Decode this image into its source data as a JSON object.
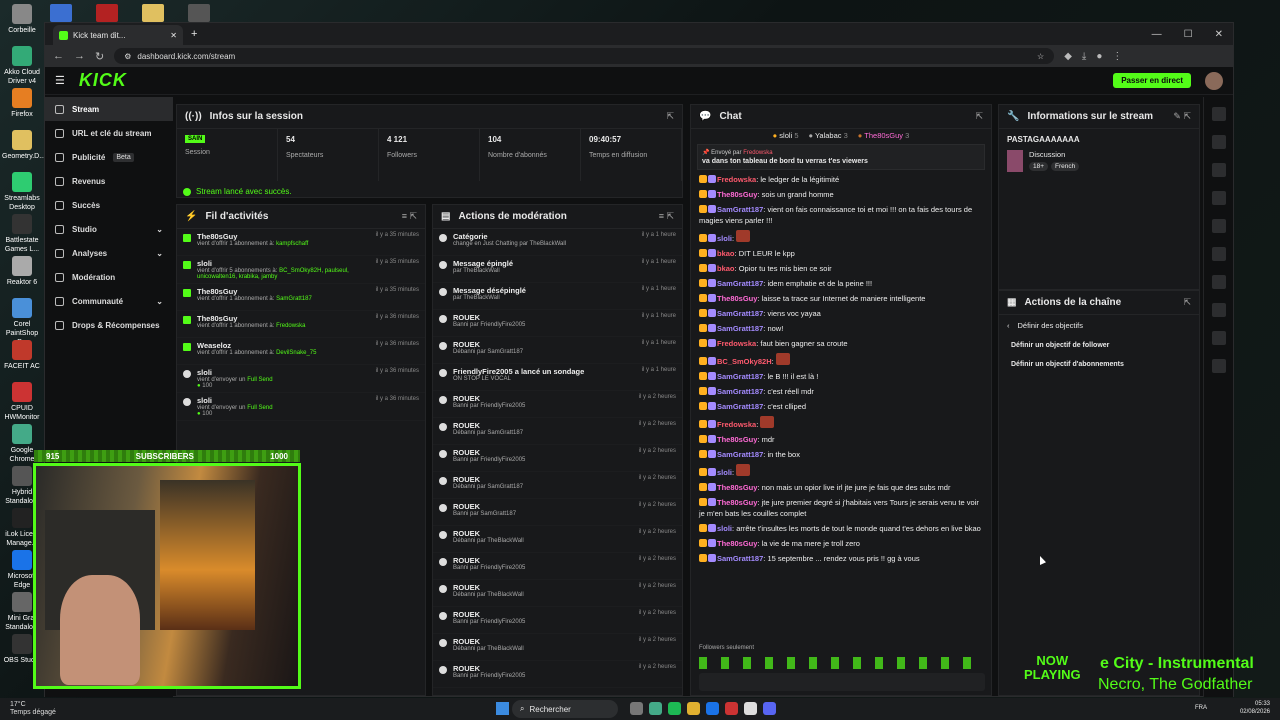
{
  "desktop": {
    "icons": [
      "Corbeille",
      "Akko Cloud Driver v4",
      "Firefox",
      "Geometry.D...",
      "Streamlabs Desktop",
      "Battlestate Games L...",
      "Reaktor 6",
      "Corel PaintShop P...",
      "FACEIT AC",
      "CPUID HWMonitor",
      "Google Chrome",
      "Hybrid Standalo...",
      "iLok Licen. Manage...",
      "Microsoft Edge",
      "Mini Gra. Standalo...",
      "OBS Studio"
    ]
  },
  "browser": {
    "tab_title": "Kick team dit...",
    "url": "dashboard.kick.com/stream",
    "win_min": "—",
    "win_max": "☐",
    "win_close": "✕"
  },
  "kick": {
    "logo": "KICK",
    "go_live": "Passer en direct"
  },
  "sidebar": {
    "items": [
      {
        "label": "Stream"
      },
      {
        "label": "URL et clé du stream"
      },
      {
        "label": "Publicité",
        "badge": "Beta"
      },
      {
        "label": "Revenus"
      },
      {
        "label": "Succès"
      },
      {
        "label": "Studio"
      },
      {
        "label": "Analyses"
      },
      {
        "label": "Modération"
      },
      {
        "label": "Communauté"
      },
      {
        "label": "Drops & Récompenses"
      }
    ]
  },
  "session": {
    "title": "Infos sur la session",
    "health": "SAIN",
    "health_label": "Session",
    "stats": [
      {
        "value": "54",
        "label": "Spectateurs"
      },
      {
        "value": "4 121",
        "label": "Followers"
      },
      {
        "value": "104",
        "label": "Nombre d'abonnés"
      },
      {
        "value": "09:40:57",
        "label": "Temps en diffusion"
      }
    ],
    "success_msg": "Stream lancé avec succès."
  },
  "activity": {
    "title": "Fil d'activités",
    "rows": [
      {
        "user": "The80sGuy",
        "line": "vient d'offrir 1 abonnement à:",
        "target": "kampfschaff",
        "time": "il y a 35 minutes"
      },
      {
        "user": "sloli",
        "line": "vient d'offrir 5 abonnements à:",
        "target": "BC_SmOky82H, paulseul, unicowalten16, krabika, jamby",
        "time": "il y a 35 minutes"
      },
      {
        "user": "The80sGuy",
        "line": "vient d'offrir 1 abonnement à:",
        "target": "SamGratt187",
        "time": "il y a 35 minutes"
      },
      {
        "user": "The80sGuy",
        "line": "vient d'offrir 1 abonnement à:",
        "target": "Fredowska",
        "time": "il y a 36 minutes"
      },
      {
        "user": "Weaseloz",
        "line": "vient d'offrir 1 abonnement à:",
        "target": "DevilSnake_75",
        "time": "il y a 36 minutes"
      },
      {
        "user": "sloli",
        "line": "vient d'envoyer un",
        "target": "Full Send",
        "extra": "100",
        "time": "il y a 36 minutes"
      },
      {
        "user": "sloli",
        "line": "vient d'envoyer un",
        "target": "Full Send",
        "extra": "100",
        "time": "il y a 36 minutes"
      }
    ]
  },
  "moderation": {
    "title": "Actions de modération",
    "rows": [
      {
        "title": "Catégorie",
        "sub": "changé en Just Chatting par TheBlackWall",
        "time": "il y a 1 heure"
      },
      {
        "title": "Message épinglé",
        "sub": "par TheBlackWall",
        "time": "il y a 1 heure"
      },
      {
        "title": "Message désépinglé",
        "sub": "par TheBlackWall",
        "time": "il y a 1 heure"
      },
      {
        "title": "ROUEK",
        "sub": "Banni par FriendlyFire2005",
        "time": "il y a 1 heure"
      },
      {
        "title": "ROUEK",
        "sub": "Débanni par SamGratt187",
        "time": "il y a 1 heure"
      },
      {
        "title": "FriendlyFire2005 a lancé un sondage",
        "sub": "ON STOP LE VOCAL",
        "time": "il y a 1 heure"
      },
      {
        "title": "ROUEK",
        "sub": "Banni par FriendlyFire2005",
        "time": "il y a 2 heures"
      },
      {
        "title": "ROUEK",
        "sub": "Débanni par SamGratt187",
        "time": "il y a 2 heures"
      },
      {
        "title": "ROUEK",
        "sub": "Banni par FriendlyFire2005",
        "time": "il y a 2 heures"
      },
      {
        "title": "ROUEK",
        "sub": "Débanni par SamGratt187",
        "time": "il y a 2 heures"
      },
      {
        "title": "ROUEK",
        "sub": "Banni par SamGratt187",
        "time": "il y a 2 heures"
      },
      {
        "title": "ROUEK",
        "sub": "Débanni par TheBlackWall",
        "time": "il y a 2 heures"
      },
      {
        "title": "ROUEK",
        "sub": "Banni par FriendlyFire2005",
        "time": "il y a 2 heures"
      },
      {
        "title": "ROUEK",
        "sub": "Débanni par TheBlackWall",
        "time": "il y a 2 heures"
      },
      {
        "title": "ROUEK",
        "sub": "Banni par FriendlyFire2005",
        "time": "il y a 2 heures"
      },
      {
        "title": "ROUEK",
        "sub": "Débanni par TheBlackWall",
        "time": "il y a 2 heures"
      },
      {
        "title": "ROUEK",
        "sub": "Banni par FriendlyFire2005",
        "time": "il y a 2 heures"
      }
    ]
  },
  "chat": {
    "title": "Chat",
    "leaders": [
      {
        "name": "sloli",
        "n": "5"
      },
      {
        "name": "Yalabac",
        "n": "3"
      },
      {
        "name": "The80sGuy",
        "n": "3"
      }
    ],
    "pinned_by": "Envoyé par",
    "pinned_user": "Fredowska",
    "pinned_text": "va dans ton tableau de bord tu verras t'es viewers",
    "messages": [
      {
        "user": "Fredowska",
        "color": "#ff5a6e",
        "text": "le ledger de la légitimité"
      },
      {
        "user": "The80sGuy",
        "color": "#ff6bd6",
        "text": "sois un grand homme"
      },
      {
        "user": "SamGratt187",
        "color": "#a48bff",
        "text": "vient on fais connaissance toi et moi !!! on ta fais des tours de magies viens parler !!!"
      },
      {
        "user": "sloli",
        "color": "#a48bff",
        "text": ""
      },
      {
        "user": "bkao",
        "color": "#ff5a6e",
        "text": "DIT LEUR le kpp"
      },
      {
        "user": "bkao",
        "color": "#ff5a6e",
        "text": "Opior tu tes mis bien ce soir"
      },
      {
        "user": "SamGratt187",
        "color": "#a48bff",
        "text": "idem emphatie et de la peine !!!"
      },
      {
        "user": "The80sGuy",
        "color": "#ff6bd6",
        "text": "laisse ta trace sur Internet de maniere intelligente"
      },
      {
        "user": "SamGratt187",
        "color": "#a48bff",
        "text": "viens voc yayaa"
      },
      {
        "user": "SamGratt187",
        "color": "#a48bff",
        "text": "now!"
      },
      {
        "user": "Fredowska",
        "color": "#ff5a6e",
        "text": "faut bien gagner sa croute"
      },
      {
        "user": "BC_SmOky82H",
        "color": "#ff5a6e",
        "text": ""
      },
      {
        "user": "SamGratt187",
        "color": "#a48bff",
        "text": "le B !!! il est là !"
      },
      {
        "user": "SamGratt187",
        "color": "#a48bff",
        "text": "c'est réell mdr"
      },
      {
        "user": "SamGratt187",
        "color": "#a48bff",
        "text": "c'est clliped"
      },
      {
        "user": "Fredowska",
        "color": "#ff5a6e",
        "text": ""
      },
      {
        "user": "The80sGuy",
        "color": "#ff6bd6",
        "text": "mdr"
      },
      {
        "user": "SamGratt187",
        "color": "#a48bff",
        "text": "in the box"
      },
      {
        "user": "sloli",
        "color": "#a48bff",
        "text": ""
      },
      {
        "user": "The80sGuy",
        "color": "#ff6bd6",
        "text": "non mais un opior live irl jte jure je fais que des subs mdr"
      },
      {
        "user": "The80sGuy",
        "color": "#ff6bd6",
        "text": "jte jure premier degré si j'habitais vers Tours je serais venu te voir je m'en bats les couilles complet"
      },
      {
        "user": "sloli",
        "color": "#a48bff",
        "text": "arrête t'insultes les morts de tout le monde quand t'es dehors en live bkao"
      },
      {
        "user": "The80sGuy",
        "color": "#ff6bd6",
        "text": "la vie de ma mere je troll zero"
      },
      {
        "user": "SamGratt187",
        "color": "#a48bff",
        "text": "15 septembre ... rendez vous pris !! gg à vous"
      }
    ],
    "followers_only": "Followers seulement"
  },
  "info": {
    "title": "Informations sur le stream",
    "stream_title": "PASTAGAAAAAAA",
    "category": "Discussion",
    "tags": [
      "18+",
      "French"
    ]
  },
  "channel_actions": {
    "title": "Actions de la chaîne",
    "back": "Définir des objectifs",
    "items": [
      "Définir un objectif de follower",
      "Définir un objectif d'abonnements"
    ]
  },
  "overlay": {
    "subs_left": "915",
    "subs_label": "SUBSCRIBERS",
    "subs_right": "1000",
    "now": "NOW",
    "playing": "PLAYING",
    "track": "e City - Instrumental",
    "artist": "Necro, The Godfather"
  },
  "taskbar": {
    "weather": "17°C",
    "weather_sub": "Temps dégagé",
    "search": "Rechercher",
    "lang": "FRA",
    "time": "05:33",
    "date": "02/08/2026"
  }
}
